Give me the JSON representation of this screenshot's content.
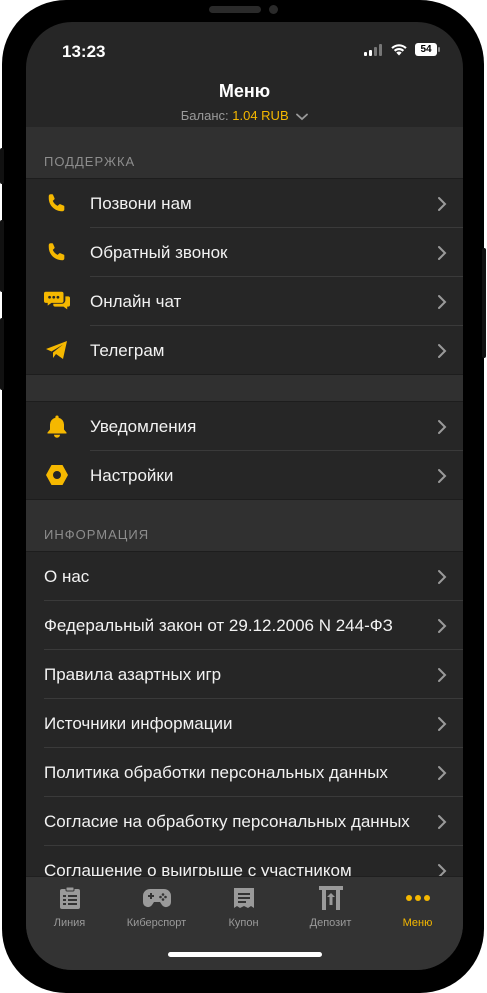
{
  "status_bar": {
    "time": "13:23",
    "battery": "54"
  },
  "header": {
    "title": "Меню",
    "balance_label": "Баланс:",
    "balance_value": "1.04 RUB"
  },
  "sections": {
    "support": {
      "title": "ПОДДЕРЖКА",
      "items": [
        {
          "label": "Позвони нам",
          "icon": "phone-icon"
        },
        {
          "label": "Обратный звонок",
          "icon": "phone-callback-icon"
        },
        {
          "label": "Онлайн чат",
          "icon": "chat-icon"
        },
        {
          "label": "Телеграм",
          "icon": "telegram-icon"
        }
      ]
    },
    "general": {
      "items": [
        {
          "label": "Уведомления",
          "icon": "bell-icon"
        },
        {
          "label": "Настройки",
          "icon": "settings-icon"
        }
      ]
    },
    "info": {
      "title": "ИНФОРМАЦИЯ",
      "items": [
        {
          "label": "О нас"
        },
        {
          "label": "Федеральный закон от 29.12.2006 N 244-ФЗ"
        },
        {
          "label": "Правила азартных игр"
        },
        {
          "label": "Источники информации"
        },
        {
          "label": "Политика обработки персональных данных"
        },
        {
          "label": "Согласие на обработку персональных данных"
        },
        {
          "label": "Соглашение о выигрыше с участником"
        }
      ]
    }
  },
  "tabbar": {
    "tabs": [
      {
        "label": "Линия",
        "icon": "list-icon"
      },
      {
        "label": "Киберспорт",
        "icon": "gamepad-icon"
      },
      {
        "label": "Купон",
        "icon": "coupon-icon"
      },
      {
        "label": "Депозит",
        "icon": "deposit-icon"
      },
      {
        "label": "Меню",
        "icon": "more-dots-icon",
        "active": true
      }
    ]
  },
  "colors": {
    "accent": "#f5b800",
    "background": "#262626",
    "section": "#303030",
    "tabbar": "#333333"
  }
}
